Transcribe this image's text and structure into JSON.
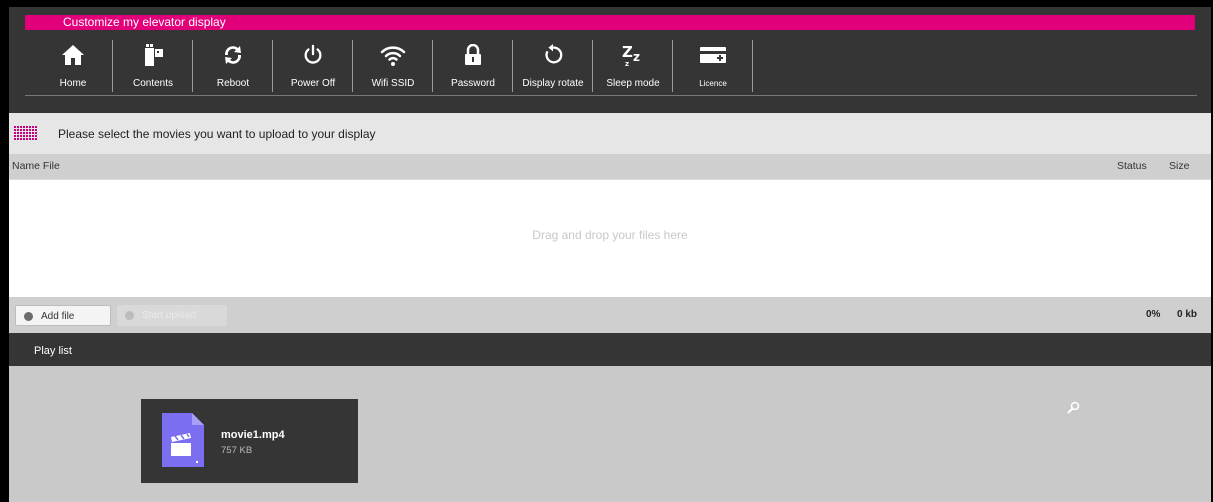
{
  "header": {
    "title": "Customize my elevator display",
    "accent_color": "#e2007a",
    "background": "#353535"
  },
  "toolbar": {
    "items": [
      {
        "label": "Home",
        "icon": "home-icon"
      },
      {
        "label": "Contents",
        "icon": "film-reel-icon"
      },
      {
        "label": "Reboot",
        "icon": "reboot-arrows-icon"
      },
      {
        "label": "Power Off",
        "icon": "power-icon"
      },
      {
        "label": "Wifi SSID",
        "icon": "wifi-icon"
      },
      {
        "label": "Password",
        "icon": "padlock-icon"
      },
      {
        "label": "Display rotate",
        "icon": "rotate-icon"
      },
      {
        "label": "Sleep mode",
        "icon": "sleep-zz-icon"
      },
      {
        "label": "Licence",
        "icon": "licence-card-icon"
      }
    ]
  },
  "upload": {
    "prompt": "Please select the movies you want to upload to your display",
    "columns": {
      "name": "Name File",
      "status": "Status",
      "size": "Size"
    },
    "dropzone_hint": "Drag and drop your files here",
    "add_label": "Add file",
    "start_label": "Start upload",
    "progress": "0%",
    "total_size": "0 kb"
  },
  "playlist": {
    "title": "Play list",
    "files": [
      {
        "name": "movie1.mp4",
        "size": "757 KB",
        "icon": "video-file-icon"
      }
    ]
  }
}
